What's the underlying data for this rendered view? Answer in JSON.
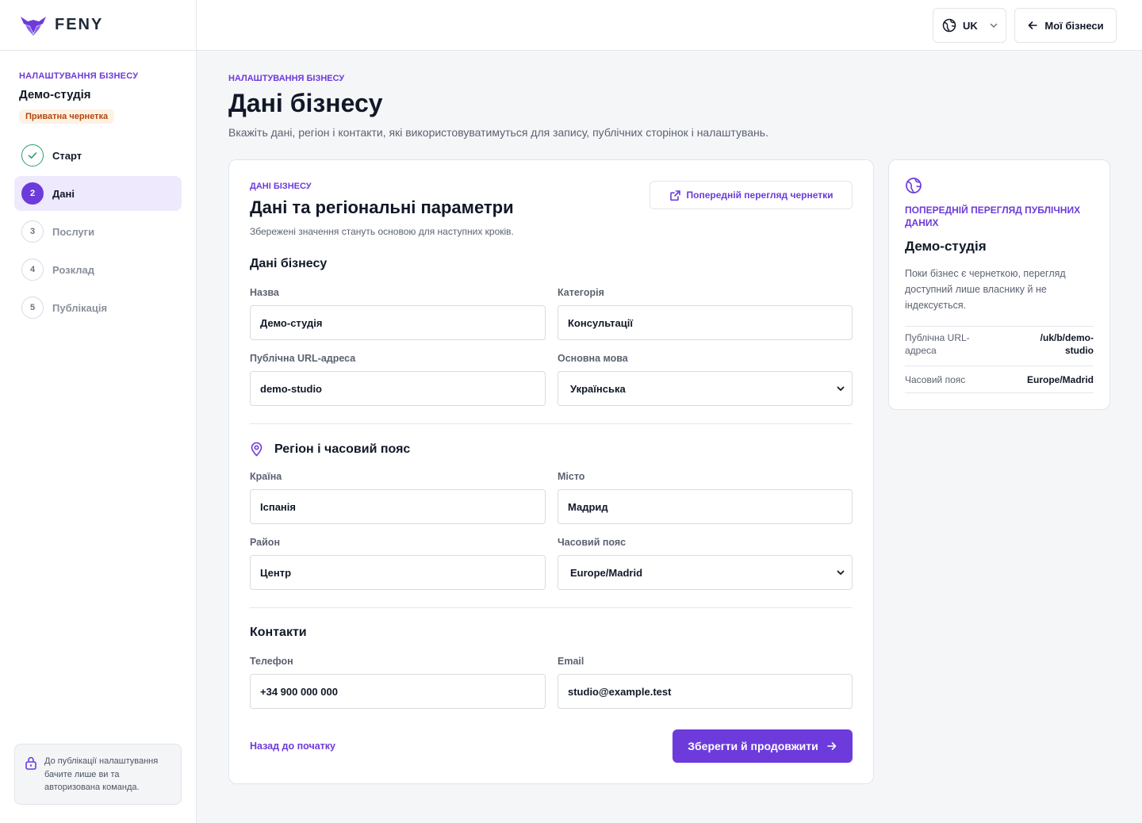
{
  "brand": {
    "name": "FENY",
    "accent": "#6d3bdb"
  },
  "sidebar": {
    "eyebrow": "НАЛАШТУВАННЯ БІЗНЕСУ",
    "business_name": "Демо-студія",
    "badge": "Приватна чернетка",
    "steps": [
      {
        "num": "",
        "label": "Старт",
        "state": "done"
      },
      {
        "num": "2",
        "label": "Дані",
        "state": "active"
      },
      {
        "num": "3",
        "label": "Послуги",
        "state": "pending"
      },
      {
        "num": "4",
        "label": "Розклад",
        "state": "pending"
      },
      {
        "num": "5",
        "label": "Публікація",
        "state": "pending"
      }
    ],
    "note": "До публікації налаштування бачите лише ви та авторизована команда."
  },
  "topbar": {
    "lang": "UK",
    "my_businesses": "Мої бізнеси"
  },
  "page": {
    "eyebrow": "НАЛАШТУВАННЯ БІЗНЕСУ",
    "title": "Дані бізнесу",
    "description": "Вкажіть дані, регіон і контакти, які використовуватимуться для запису, публічних сторінок і налаштувань."
  },
  "form": {
    "eyebrow": "ДАНІ БІЗНЕСУ",
    "title": "Дані та регіональні параметри",
    "subtitle": "Збережені значення стануть основою для наступних кроків.",
    "preview_button": "Попередній перегляд чернетки",
    "section_business": "Дані бізнесу",
    "name_label": "Назва",
    "name_value": "Демо-студія",
    "category_label": "Категорія",
    "category_value": "Консультації",
    "url_label": "Публічна URL-адреса",
    "url_value": "demo-studio",
    "language_label": "Основна мова",
    "language_value": "Українська",
    "section_region": "Регіон і часовий пояс",
    "country_label": "Країна",
    "country_value": "Іспанія",
    "city_label": "Місто",
    "city_value": "Мадрид",
    "district_label": "Район",
    "district_value": "Центр",
    "timezone_label": "Часовий пояс",
    "timezone_value": "Europe/Madrid",
    "section_contacts": "Контакти",
    "phone_label": "Телефон",
    "phone_value": "+34 900 000 000",
    "email_label": "Email",
    "email_value": "studio@example.test",
    "back_link": "Назад до початку",
    "save_button": "Зберегти й продовжити"
  },
  "preview": {
    "eyebrow": "ПОПЕРЕДНІЙ ПЕРЕГЛЯД ПУБЛІЧНИХ ДАНИХ",
    "title": "Демо-студія",
    "text": "Поки бізнес є чернеткою, перегляд доступний лише власнику й не індексується.",
    "url_key": "Публічна URL-адреса",
    "url_value": "/uk/b/demo-studio",
    "tz_key": "Часовий пояс",
    "tz_value": "Europe/Madrid"
  }
}
